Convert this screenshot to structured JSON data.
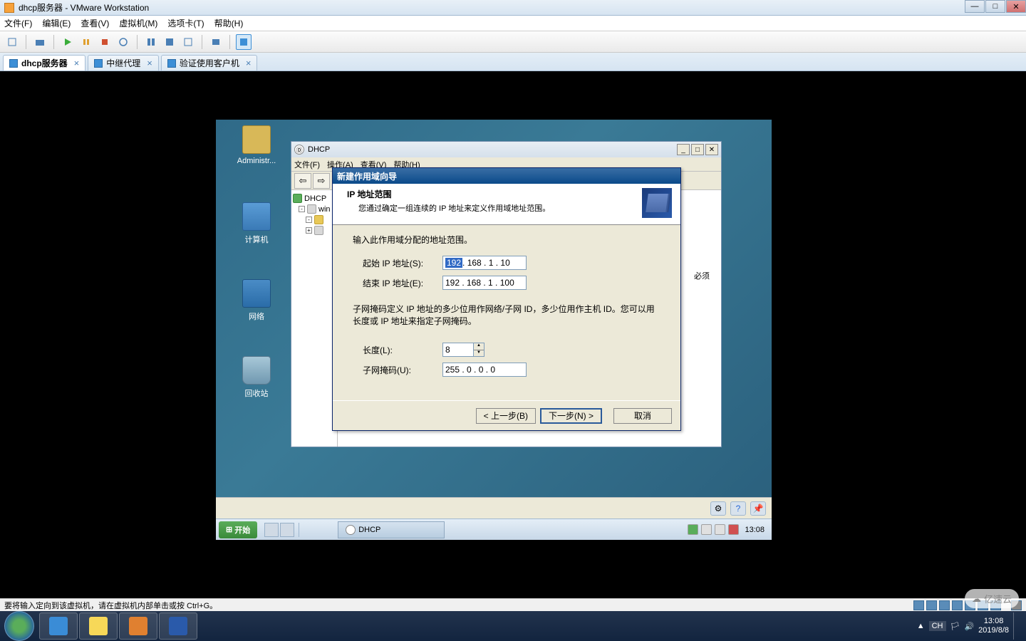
{
  "host_window": {
    "title": "dhcp服务器 - VMware Workstation",
    "minimize": "—",
    "maximize": "□",
    "close": "✕"
  },
  "vm_menu": [
    "文件(F)",
    "编辑(E)",
    "查看(V)",
    "虚拟机(M)",
    "选项卡(T)",
    "帮助(H)"
  ],
  "vm_tabs": [
    {
      "label": "dhcp服务器",
      "active": true
    },
    {
      "label": "中继代理",
      "active": false
    },
    {
      "label": "验证使用客户机",
      "active": false
    }
  ],
  "desktop_icons": [
    {
      "label": "Administr...",
      "kind": "folder"
    },
    {
      "label": "计算机",
      "kind": "comp"
    },
    {
      "label": "网络",
      "kind": "net"
    },
    {
      "label": "回收站",
      "kind": "bin"
    }
  ],
  "mmc": {
    "title": "DHCP",
    "menu": [
      "文件(F)",
      "操作(A)",
      "查看(V)",
      "帮助(H)"
    ],
    "tree": {
      "root": "DHCP",
      "server": "win",
      "scope_hint": "必须"
    }
  },
  "wizard": {
    "title": "新建作用域向导",
    "header_title": "IP 地址范围",
    "header_sub": "您通过确定一组连续的 IP 地址来定义作用域地址范围。",
    "intro": "输入此作用域分配的地址范围。",
    "labels": {
      "start_ip": "起始 IP 地址(S):",
      "end_ip": "结束 IP 地址(E):",
      "length": "长度(L):",
      "mask": "子网掩码(U):"
    },
    "values": {
      "start_ip_sel": "192",
      "start_ip_rest": " . 168 .  1  .  10",
      "end_ip": "192 . 168 .  1  . 100",
      "length": "8",
      "mask": "255 .  0  .  0  .  0"
    },
    "subnet_note": "子网掩码定义 IP 地址的多少位用作网络/子网 ID，多少位用作主机 ID。您可以用长度或 IP 地址来指定子网掩码。",
    "buttons": {
      "back": "< 上一步(B)",
      "next": "下一步(N) >",
      "cancel": "取消"
    }
  },
  "guest_taskbar": {
    "start": "开始",
    "task_item": "DHCP",
    "clock": "13:08"
  },
  "status_bar": {
    "hint": "要将输入定向到该虚拟机，请在虚拟机内部单击或按 Ctrl+G。"
  },
  "host_tray": {
    "time": "13:08",
    "date": "2019/8/8",
    "ime": "CH"
  },
  "watermark": "亿速云"
}
